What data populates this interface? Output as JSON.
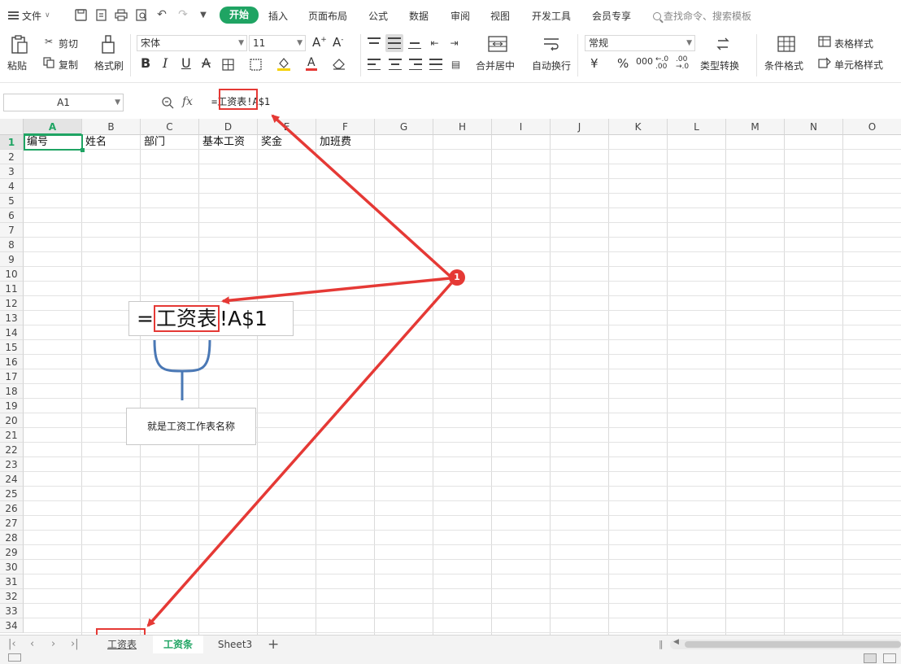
{
  "menu": {
    "file": "文件",
    "tabs": [
      "开始",
      "插入",
      "页面布局",
      "公式",
      "数据",
      "审阅",
      "视图",
      "开发工具",
      "会员专享"
    ],
    "search_placeholder": "查找命令、搜索模板"
  },
  "ribbon": {
    "paste": "粘贴",
    "cut": "剪切",
    "copy": "复制",
    "format_painter": "格式刷",
    "font_name": "宋体",
    "font_size": "11",
    "bold": "B",
    "italic": "I",
    "underline": "U",
    "strike": "A",
    "merge": "合并居中",
    "wrap": "自动换行",
    "number_format": "常规",
    "currency": "¥",
    "percent": "%",
    "thousands": "000",
    "inc_dec": "←.0 .00",
    "dec_dec": ".00 →.0",
    "type_convert": "类型转换",
    "cond_format": "条件格式",
    "table_style": "表格样式",
    "cell_style": "单元格样式"
  },
  "formula_bar": {
    "name_box": "A1",
    "fx": "fx",
    "formula_prefix": "=",
    "formula_sheet": "工资表",
    "formula_rest": "!A$1"
  },
  "grid": {
    "columns": [
      "A",
      "B",
      "C",
      "D",
      "E",
      "F",
      "G",
      "H",
      "I",
      "J",
      "K",
      "L",
      "M",
      "N",
      "O"
    ],
    "rows": [
      "1",
      "2",
      "3",
      "4",
      "5",
      "6",
      "7",
      "8",
      "9",
      "10",
      "11",
      "12",
      "13",
      "14",
      "15",
      "16",
      "17",
      "18",
      "19",
      "20",
      "21",
      "22",
      "23",
      "24",
      "25",
      "26",
      "27",
      "28",
      "29",
      "30",
      "31",
      "32",
      "33",
      "34"
    ],
    "header_row": [
      "编号",
      "姓名",
      "部门",
      "基本工资",
      "奖金",
      "加班费"
    ],
    "active_cell": "A1"
  },
  "callout": {
    "prefix": "=",
    "sheet": "工资表",
    "rest": "!A$1",
    "note": "就是工资工作表名称",
    "marker": "1"
  },
  "sheets": {
    "tabs": [
      "工资表",
      "工资条",
      "Sheet3"
    ],
    "active": "工资条"
  },
  "colors": {
    "accent": "#1fa463",
    "annotation": "#e53935",
    "brace": "#4a78b5"
  }
}
